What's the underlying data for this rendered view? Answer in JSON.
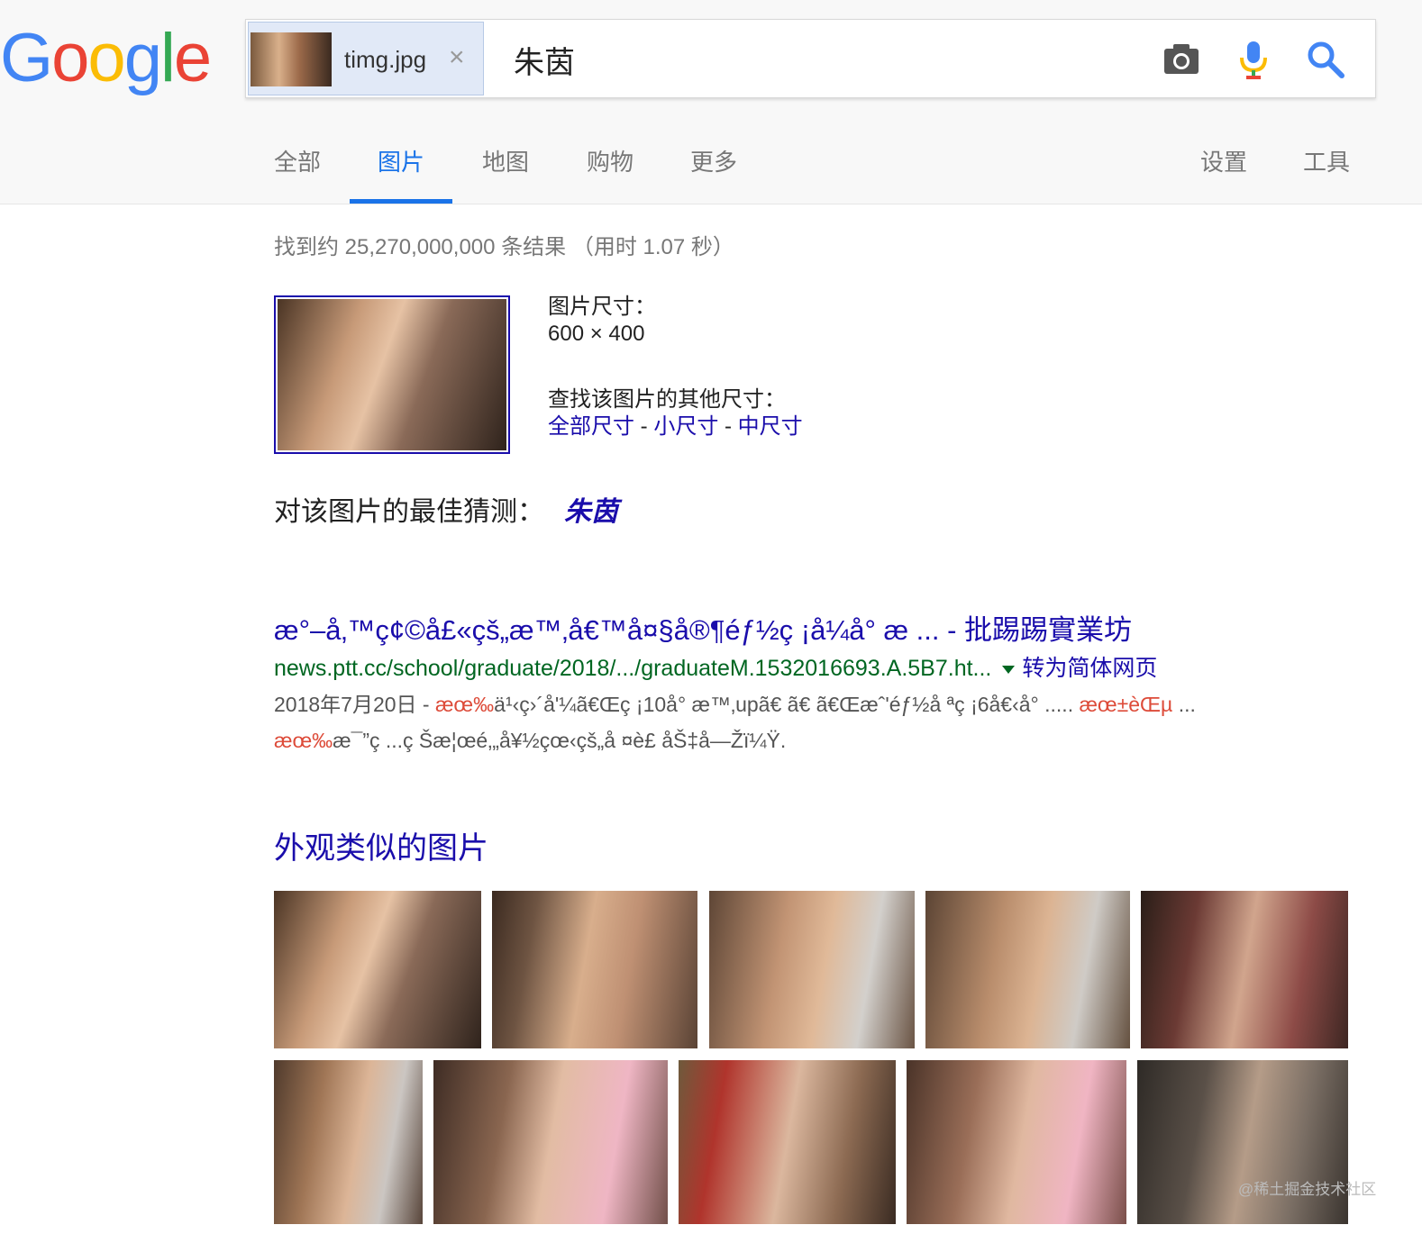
{
  "logo": [
    "G",
    "o",
    "o",
    "g",
    "l",
    "e"
  ],
  "logo_colors": [
    "#4285f4",
    "#ea4335",
    "#fbbc05",
    "#4285f4",
    "#34a853",
    "#ea4335"
  ],
  "search": {
    "image_chip_label": "timg.jpg",
    "chip_close": "×",
    "query": "朱茵"
  },
  "tabs": [
    {
      "label": "全部"
    },
    {
      "label": "图片",
      "active": true
    },
    {
      "label": "地图"
    },
    {
      "label": "购物"
    },
    {
      "label": "更多"
    }
  ],
  "tools": {
    "settings": "设置",
    "tools": "工具"
  },
  "stats": "找到约 25,270,000,000 条结果 （用时 1.07 秒）",
  "image_info": {
    "size_label": "图片尺寸：",
    "size_value": "600 × 400",
    "other_sizes_label": "查找该图片的其他尺寸：",
    "all_sizes": "全部尺寸",
    "separator": " - ",
    "small_size": "小尺寸",
    "medium_size": "中尺寸"
  },
  "best_guess": {
    "label": "对该图片的最佳猜测：",
    "value": "朱茵"
  },
  "result": {
    "title": "æ°–å‚™ç¢©å£«çš„æ™‚å€™å¤§å®¶éƒ½ç ¡å¼å° æ ... - 批踢踢實業坊",
    "url": "news.ptt.cc/school/graduate/2018/.../graduateM.1532016693.A.5B7.ht...",
    "translate": "转为简体网页",
    "snippet_line1_a": "2018年7月20日 - ",
    "snippet_line1_hl1": "æœ‰",
    "snippet_line1_b": "ä¹‹ç›´å'¼ã€Œç ¡10å° æ™‚upã€ ã€ ã€Œæˆ'éƒ½å ªç ¡6å€‹å° ..... ",
    "snippet_line1_hl2": "æœ±èŒµ",
    "snippet_line1_c": " ...",
    "snippet_line2_hl": "æœ‰",
    "snippet_line2_b": "æ¯”ç ...ç Šæ¦œé‚„å¥½çœ‹çš„å ¤è£ åŠ‡å—Žï¼Ÿ."
  },
  "similar_title": "外观类似的图片",
  "watermark": "@稀土掘金技术社区"
}
